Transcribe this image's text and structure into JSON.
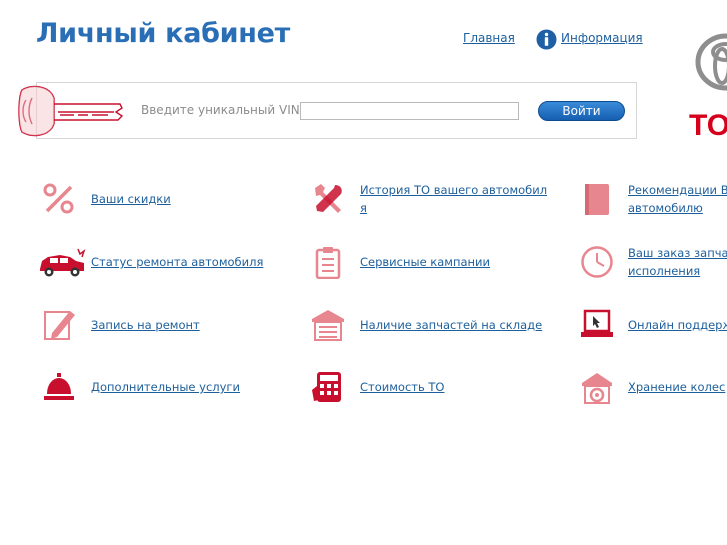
{
  "header": {
    "title": "Личный кабинет",
    "home_link": "Главная",
    "info_link": "Информация"
  },
  "vin": {
    "label": "Введите уникальный VIN",
    "value": "",
    "button": "Войти"
  },
  "logo": {
    "text": "TO",
    "brand_color": "#d6001c"
  },
  "colors": {
    "accent": "#2a6fb5",
    "link": "#1d5f9c",
    "icon_red": "#c8102e",
    "icon_pink": "#e8868f"
  },
  "menu": {
    "col1": [
      {
        "label": "Ваши скидки",
        "icon": "percent-icon"
      },
      {
        "label": "Статус ремонта автомобиля",
        "icon": "broken-car-icon"
      },
      {
        "label": "Запись на ремонт",
        "icon": "pencil-note-icon"
      },
      {
        "label": "Дополнительные услуги",
        "icon": "service-bell-icon"
      }
    ],
    "col2": [
      {
        "line1": "История ТО вашего автомобил",
        "line2": "я",
        "icon": "wrench-tools-icon"
      },
      {
        "label": "Сервисные кампании",
        "icon": "clipboard-icon"
      },
      {
        "label": "Наличие запчастей на складе",
        "icon": "warehouse-icon"
      },
      {
        "label": "Стоимость ТО",
        "icon": "calculator-icon"
      }
    ],
    "col3": [
      {
        "line1": "Рекомендации В",
        "line2": "автомобилю",
        "icon": "book-icon"
      },
      {
        "line1": "Ваш заказ запча",
        "line2": "исполнения",
        "icon": "clock-icon"
      },
      {
        "label": "Онлайн поддерж",
        "icon": "laptop-icon"
      },
      {
        "label": "Хранение колес",
        "icon": "tire-storage-icon"
      }
    ]
  }
}
